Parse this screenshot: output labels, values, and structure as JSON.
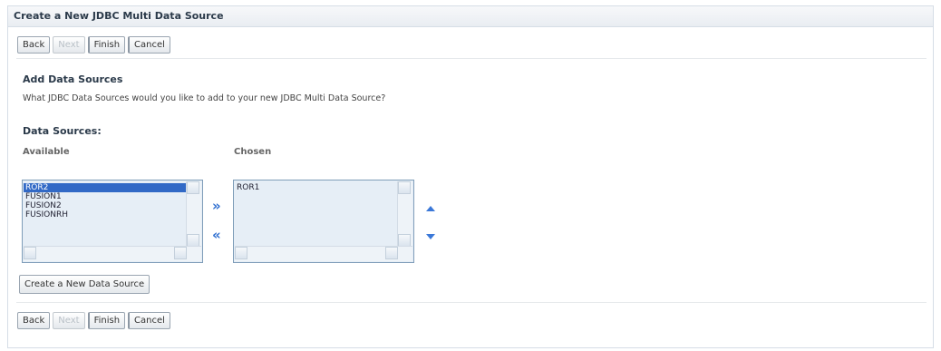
{
  "window": {
    "title": "Create a New JDBC Multi Data Source"
  },
  "nav_buttons": {
    "back": "Back",
    "next": "Next",
    "finish": "Finish",
    "cancel": "Cancel"
  },
  "section": {
    "heading": "Add Data Sources",
    "description": "What JDBC Data Sources would you like to add to your new JDBC Multi Data Source?",
    "data_sources_label": "Data Sources:"
  },
  "available": {
    "label": "Available",
    "items": [
      "ROR2",
      "FUSION1",
      "FUSION2",
      "FUSIONRH"
    ],
    "selected": "ROR2"
  },
  "chosen": {
    "label": "Chosen",
    "items": [
      "ROR1"
    ]
  },
  "move_controls": {
    "add": "»",
    "remove": "«"
  },
  "create_button": "Create a New Data Source",
  "icons": [
    "move-right-icon",
    "move-left-icon",
    "move-up-icon",
    "move-down-icon"
  ]
}
